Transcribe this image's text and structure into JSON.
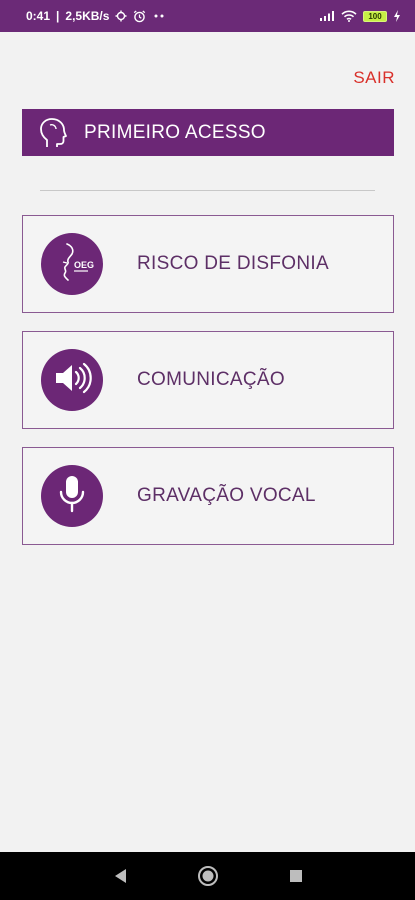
{
  "status_bar": {
    "time": "0:41",
    "network_speed": "2,5KB/s",
    "icons_left": [
      "usb-settings-icon",
      "alarm-icon",
      "more-dots-icon"
    ],
    "icons_right": [
      "signal-icon",
      "wifi-icon",
      "battery-icon",
      "charging-icon"
    ],
    "battery_level": "100"
  },
  "toolbar": {
    "logout_label": "SAIR"
  },
  "header": {
    "icon": "head-silhouette-icon",
    "title": "PRIMEIRO ACESSO"
  },
  "menu": {
    "items": [
      {
        "icon": "speaking-face-icon",
        "label": "RISCO DE DISFONIA"
      },
      {
        "icon": "speaker-volume-icon",
        "label": "COMUNICAÇÃO"
      },
      {
        "icon": "microphone-icon",
        "label": "GRAVAÇÃO VOCAL"
      }
    ]
  },
  "nav_bar": {
    "buttons": [
      "back-icon",
      "home-icon",
      "recents-icon"
    ]
  },
  "colors": {
    "primary": "#6c2776",
    "status_bar": "#6b2a77",
    "logout": "#d9302a",
    "card_border": "#8a5a92",
    "card_text": "#5d2f66",
    "background": "#f2f2f2"
  }
}
